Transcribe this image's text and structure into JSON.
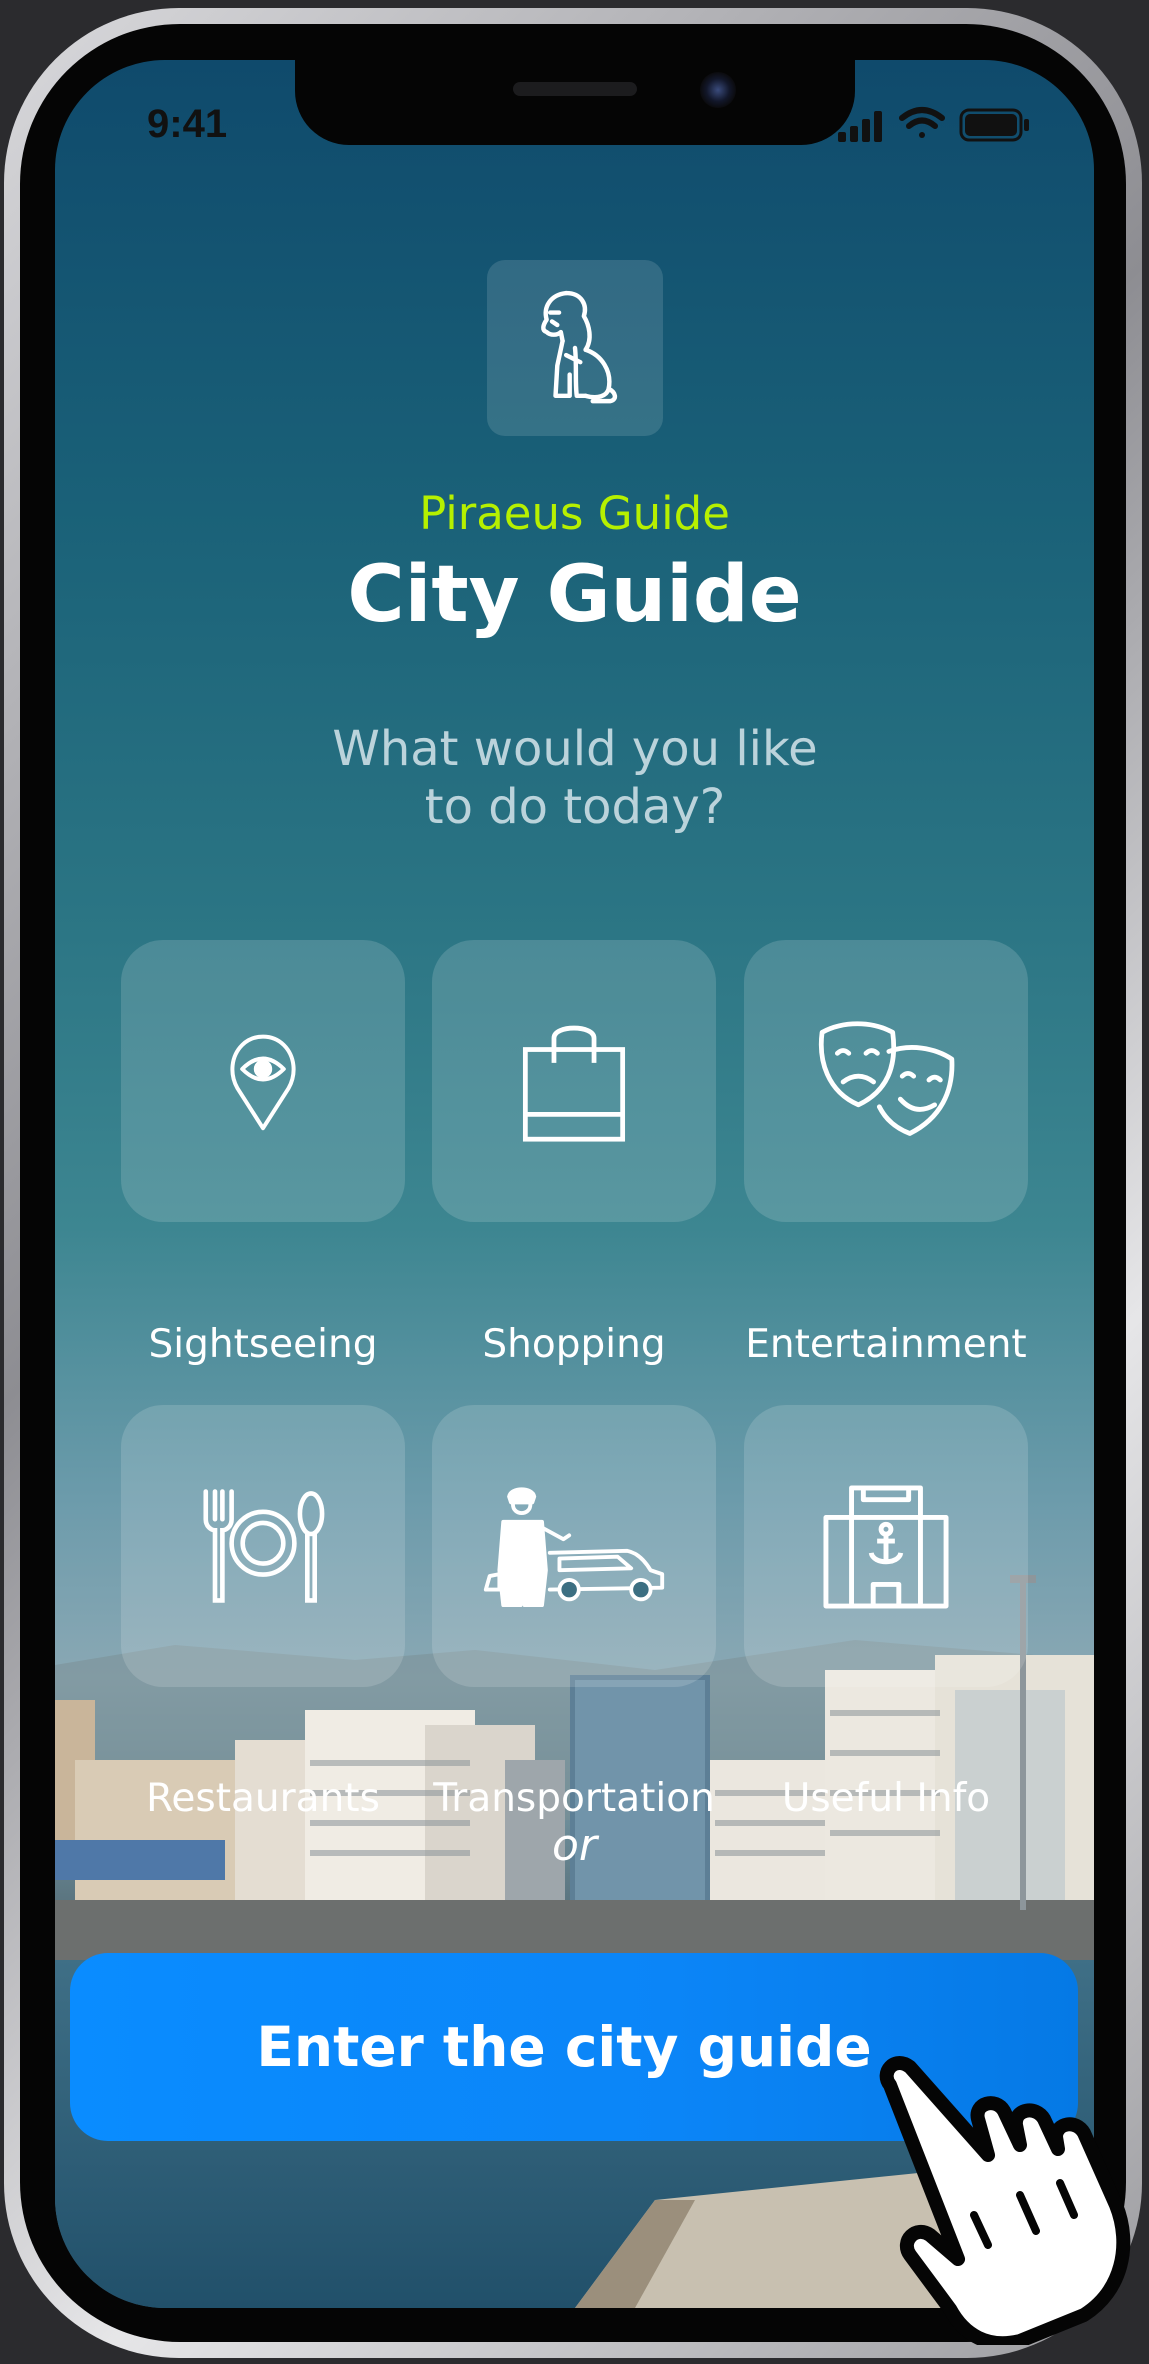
{
  "status_bar": {
    "time": "9:41"
  },
  "brand": "Piraeus Guide",
  "title": "City Guide",
  "question_line1": "What would you like",
  "question_line2": "to do today?",
  "categories": [
    {
      "label": "Sightseeing",
      "icon": "eye-pin-icon"
    },
    {
      "label": "Shopping",
      "icon": "shopping-bag-icon"
    },
    {
      "label": "Entertainment",
      "icon": "theater-masks-icon"
    },
    {
      "label": "Restaurants",
      "icon": "plate-cutlery-icon"
    },
    {
      "label": "Transportation",
      "icon": "chauffeur-limousine-icon"
    },
    {
      "label": "Useful Info",
      "icon": "anchor-building-icon"
    }
  ],
  "or_text": "or",
  "cta_label": "Enter the city guide",
  "colors": {
    "brand": "#b6f000",
    "cta": "#0a8cff"
  }
}
